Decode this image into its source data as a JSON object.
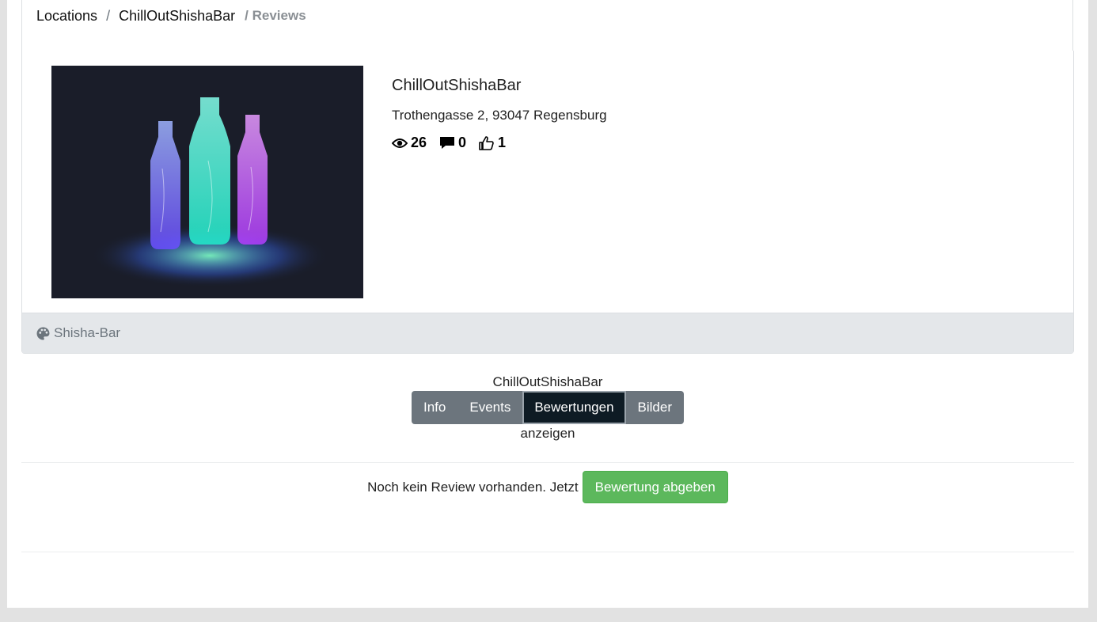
{
  "breadcrumb": {
    "items": [
      "Locations",
      "ChillOutShishaBar"
    ],
    "separator": "/",
    "active": "/ Reviews"
  },
  "venue": {
    "name": "ChillOutShishaBar",
    "address": "Trothengasse 2, 93047 Regensburg",
    "stats": {
      "views": "26",
      "comments": "0",
      "likes": "1"
    },
    "category": "Shisha-Bar",
    "photo_icon": "glowing-bottles-image"
  },
  "tabs": {
    "title": "ChillOutShishaBar",
    "items": [
      "Info",
      "Events",
      "Bewertungen",
      "Bilder"
    ],
    "active": "Bewertungen",
    "subtitle": "anzeigen"
  },
  "reviews": {
    "empty_text": "Noch kein Review vorhanden. Jetzt",
    "cta_label": "Bewertung abgeben"
  },
  "colors": {
    "success": "#5cb85c",
    "tab_bg": "#6c757d",
    "tab_active": "#0e1b24",
    "footer_bg": "#e4e7ea",
    "photo_bg": "#1a1d29"
  }
}
